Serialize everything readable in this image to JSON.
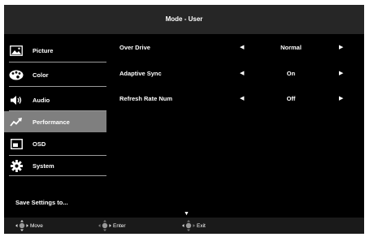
{
  "header": {
    "title": "Mode - User"
  },
  "sidebar": {
    "items": [
      {
        "label": "Picture",
        "icon": "picture-icon"
      },
      {
        "label": "Color",
        "icon": "palette-icon"
      },
      {
        "label": "Audio",
        "icon": "speaker-icon"
      },
      {
        "label": "Performance",
        "icon": "performance-icon",
        "selected": true
      },
      {
        "label": "OSD",
        "icon": "osd-icon"
      },
      {
        "label": "System",
        "icon": "gear-icon"
      }
    ],
    "save_label": "Save Settings to..."
  },
  "settings": [
    {
      "label": "Over Drive",
      "value": "Normal"
    },
    {
      "label": "Adaptive Sync",
      "value": "On"
    },
    {
      "label": "Refresh Rate Num",
      "value": "Off"
    }
  ],
  "footer": {
    "move_label": "Move",
    "enter_label": "Enter",
    "exit_label": "Exit"
  },
  "colors": {
    "background": "#000000",
    "title_bar": "#262626",
    "selected_item": "#7f7f7f",
    "text": "#ffffff"
  }
}
